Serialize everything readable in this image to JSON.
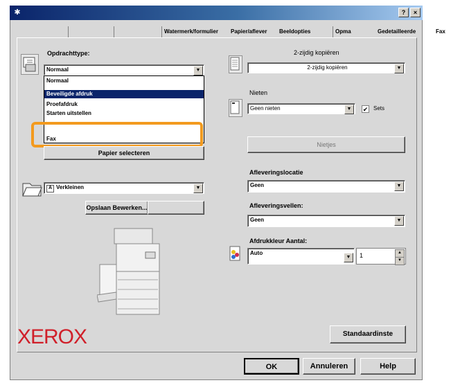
{
  "window": {
    "help_button": "?",
    "close_button": "×"
  },
  "tabs": [
    {
      "label": ""
    },
    {
      "label": ""
    },
    {
      "label": "Watermerk/formulier"
    },
    {
      "label": "Papier/aflever"
    },
    {
      "label": "Beeldopties"
    },
    {
      "label": "Opma"
    },
    {
      "label": "Gedetailleerde"
    },
    {
      "label": "Fax"
    }
  ],
  "left": {
    "job_type_label": "Opdrachttype:",
    "job_type_value": "Normaal",
    "job_type_options": [
      "Normaal",
      "Beveiligde afdruk",
      "Proefafdruk",
      "Starten uitstellen",
      "",
      "Fax"
    ],
    "selected_option": "Beveiligde afdruk",
    "paper_select_button": "Papier selecteren",
    "reduce_value": "Verkleinen",
    "save_edit_button": "Opslaan Bewerken..."
  },
  "right": {
    "duplex_label": "2-zijdig kopiëren",
    "duplex_value": "2-zijdig kopiëren",
    "staple_label": "Nieten",
    "staple_value": "Geen nieten",
    "sets_label": "Sets",
    "sets_checked": true,
    "stapler_button": "Nietjes",
    "output_location_label": "Afleveringslocatie",
    "output_location_value": "Geen",
    "output_sheets_label": "Afleveringsvellen:",
    "output_sheets_value": "Geen",
    "color_label": "Afdrukkleur Aantal:",
    "color_value": "Auto",
    "quantity_value": "1",
    "defaults_button": "Standaardinste"
  },
  "brand": {
    "logo_text": "XEROX",
    "logo_color": "#d0202a"
  },
  "footer": {
    "ok": "OK",
    "cancel": "Annuleren",
    "help": "Help"
  },
  "colors": {
    "highlight": "#f39a1e",
    "selection": "#0a246a",
    "titlebar": "#0a246a"
  }
}
